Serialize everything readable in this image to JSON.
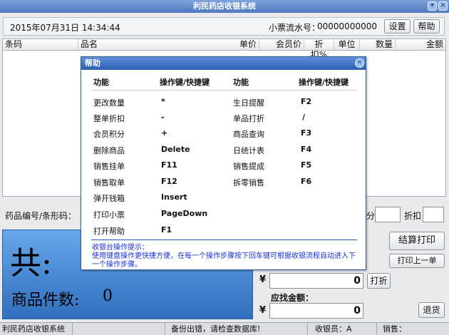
{
  "window": {
    "title": "利民药店收银系统"
  },
  "top": {
    "datetime": "2015年07月31日  14:34:44",
    "serial_label": "小票流水号：",
    "serial_value": "00000000000",
    "settings": "设置",
    "help": "帮助"
  },
  "table": {
    "headers": [
      "条码",
      "品名",
      "单价",
      "会员价",
      "折扣%",
      "单位",
      "数量",
      "金额"
    ]
  },
  "search": {
    "label": "药品编号/条形码：",
    "discount_label": "分",
    "item_discount_label": "折扣"
  },
  "panel": {
    "total_char": "共:",
    "count_label": "商品件数:",
    "count_value": "0"
  },
  "right": {
    "checkout_print": "结算打印",
    "reprint": "打印上一单",
    "yen": "¥",
    "amount_value": "0",
    "discount_btn": "打折",
    "change_label": "应找金额：",
    "change_value": "0",
    "refund": "退货"
  },
  "help_dialog": {
    "title": "帮助",
    "col_func": "功能",
    "col_key": "操作键/快捷键",
    "left_rows": [
      {
        "func": "更改数量",
        "key": "*"
      },
      {
        "func": "整单折扣",
        "key": "-"
      },
      {
        "func": "会员积分",
        "key": "+"
      },
      {
        "func": "删除商品",
        "key": "Delete"
      },
      {
        "func": "销售挂单",
        "key": "F11"
      },
      {
        "func": "销售取单",
        "key": "F12"
      },
      {
        "func": "弹开钱箱",
        "key": "Insert"
      },
      {
        "func": "打印小票",
        "key": "PageDown"
      },
      {
        "func": "打开帮助",
        "key": "F1"
      }
    ],
    "right_rows": [
      {
        "func": "生日提醒",
        "key": "F2"
      },
      {
        "func": "单品打折",
        "key": "/"
      },
      {
        "func": "商品查询",
        "key": "F3"
      },
      {
        "func": "日统计表",
        "key": "F4"
      },
      {
        "func": "销售提成",
        "key": "F5"
      },
      {
        "func": "拆零销售",
        "key": "F6"
      }
    ],
    "tip_title": "收银台操作提示：",
    "tip_text": "使用键盘操作更快捷方便，在每一个操作步骤按下回车键可根据收银流程自动进入下一个操作步骤。"
  },
  "status": {
    "app": "利民药店收银系统",
    "warning": "备份出错，请检查数据库!",
    "cashier": "收银员：A",
    "sales": "销售："
  }
}
